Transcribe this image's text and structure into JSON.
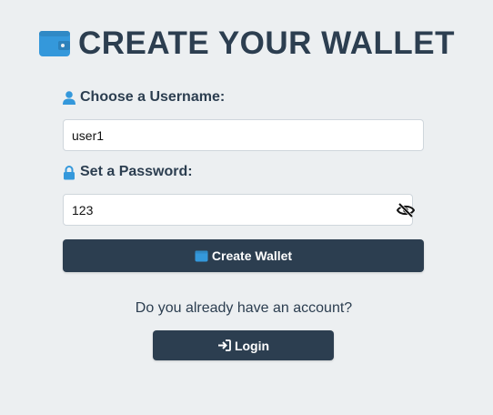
{
  "header": {
    "title": "CREATE YOUR WALLET",
    "icon": "wallet-icon"
  },
  "form": {
    "username_label": "Choose a Username:",
    "username_icon": "user-icon",
    "username_value": "user1",
    "password_label": "Set a Password:",
    "password_icon": "lock-icon",
    "password_value": "123",
    "password_visible": true,
    "visibility_toggle_icon": "eye-slash-icon",
    "submit_label": "Create Wallet",
    "submit_icon": "wallet-icon"
  },
  "login": {
    "prompt": "Do you already have an account?",
    "button_label": "Login",
    "button_icon": "sign-in-icon"
  },
  "colors": {
    "background": "#eceff1",
    "primary_dark": "#2c3e50",
    "accent_blue": "#3498db",
    "input_background": "#ffffff"
  }
}
